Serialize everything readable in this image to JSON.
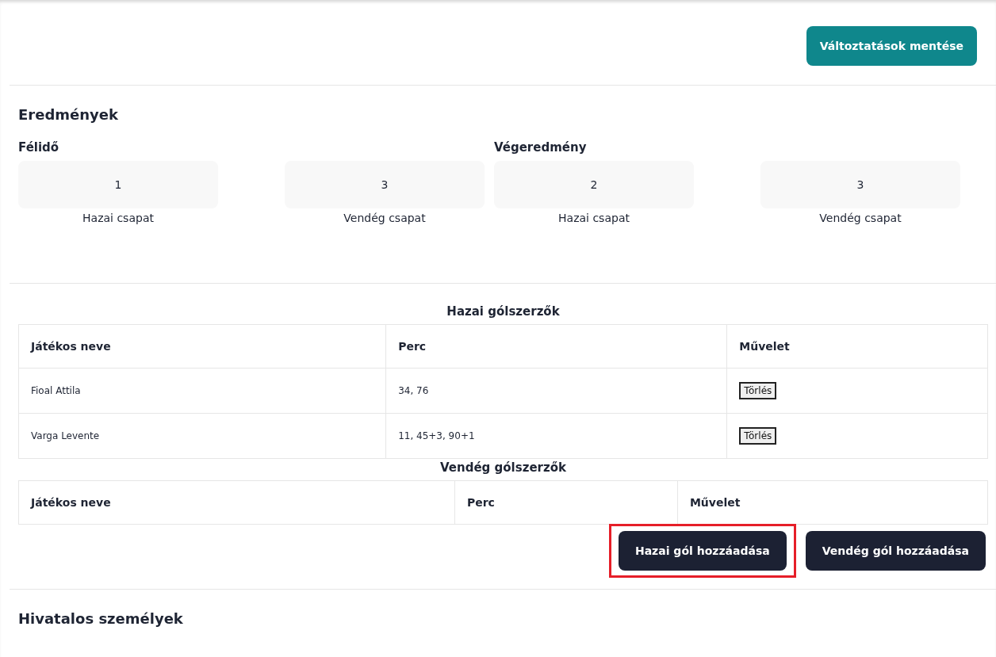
{
  "save_button": {
    "label": "Változtatások mentése"
  },
  "results": {
    "title": "Eredmények",
    "groups": [
      {
        "title": "Félidő",
        "scores": [
          {
            "value": "1",
            "label": "Hazai csapat"
          },
          {
            "value": "3",
            "label": "Vendég csapat"
          }
        ]
      },
      {
        "title": "Végeredmény",
        "scores": [
          {
            "value": "2",
            "label": "Hazai csapat"
          },
          {
            "value": "3",
            "label": "Vendég csapat"
          }
        ]
      }
    ]
  },
  "scorers": [
    {
      "title": "Hazai gólszerzők",
      "columns": [
        "Játékos neve",
        "Perc",
        "Művelet"
      ],
      "rows": [
        {
          "name": "Fioal Attila",
          "minutes": "34, 76",
          "action": "Törlés"
        },
        {
          "name": "Varga Levente",
          "minutes": "11, 45+3, 90+1",
          "action": "Törlés"
        }
      ]
    },
    {
      "title": "Vendég gólszerzők",
      "columns": [
        "Játékos neve",
        "Perc",
        "Művelet"
      ]
    }
  ],
  "add_buttons": [
    {
      "label": "Hazai gól hozzáadása",
      "highlighted": true
    },
    {
      "label": "Vendég gól hozzáadása",
      "highlighted": false
    }
  ],
  "officials": {
    "title": "Hivatalos személyek"
  }
}
